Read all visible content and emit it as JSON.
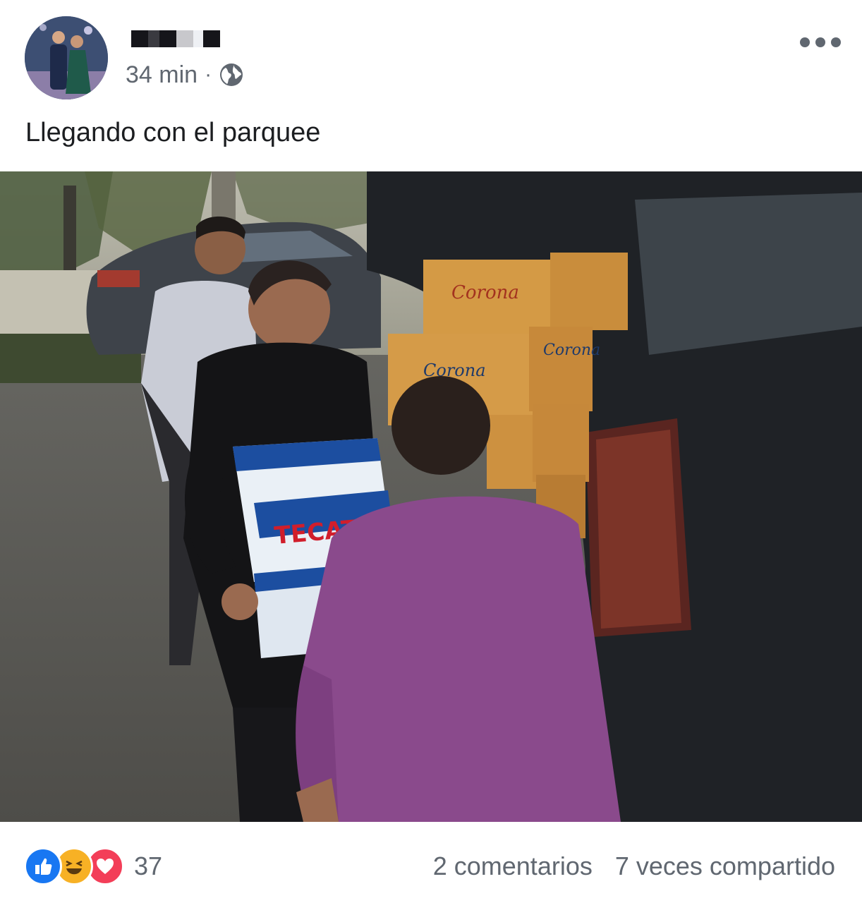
{
  "post": {
    "time": "34 min",
    "separator": "·",
    "privacy_icon": "globe-icon",
    "text": "Llegando con el parquee"
  },
  "photo": {
    "box_text_front": "TECATE",
    "box_text_back": "Corona"
  },
  "footer": {
    "reaction_icons": [
      "like-icon",
      "haha-icon",
      "love-icon"
    ],
    "reaction_count": "37",
    "comments": "2 comentarios",
    "shares": "7 veces compartido"
  },
  "colors": {
    "meta_text": "#606770",
    "like": "#1877f2",
    "haha": "#f7b125",
    "love": "#f33e58"
  }
}
